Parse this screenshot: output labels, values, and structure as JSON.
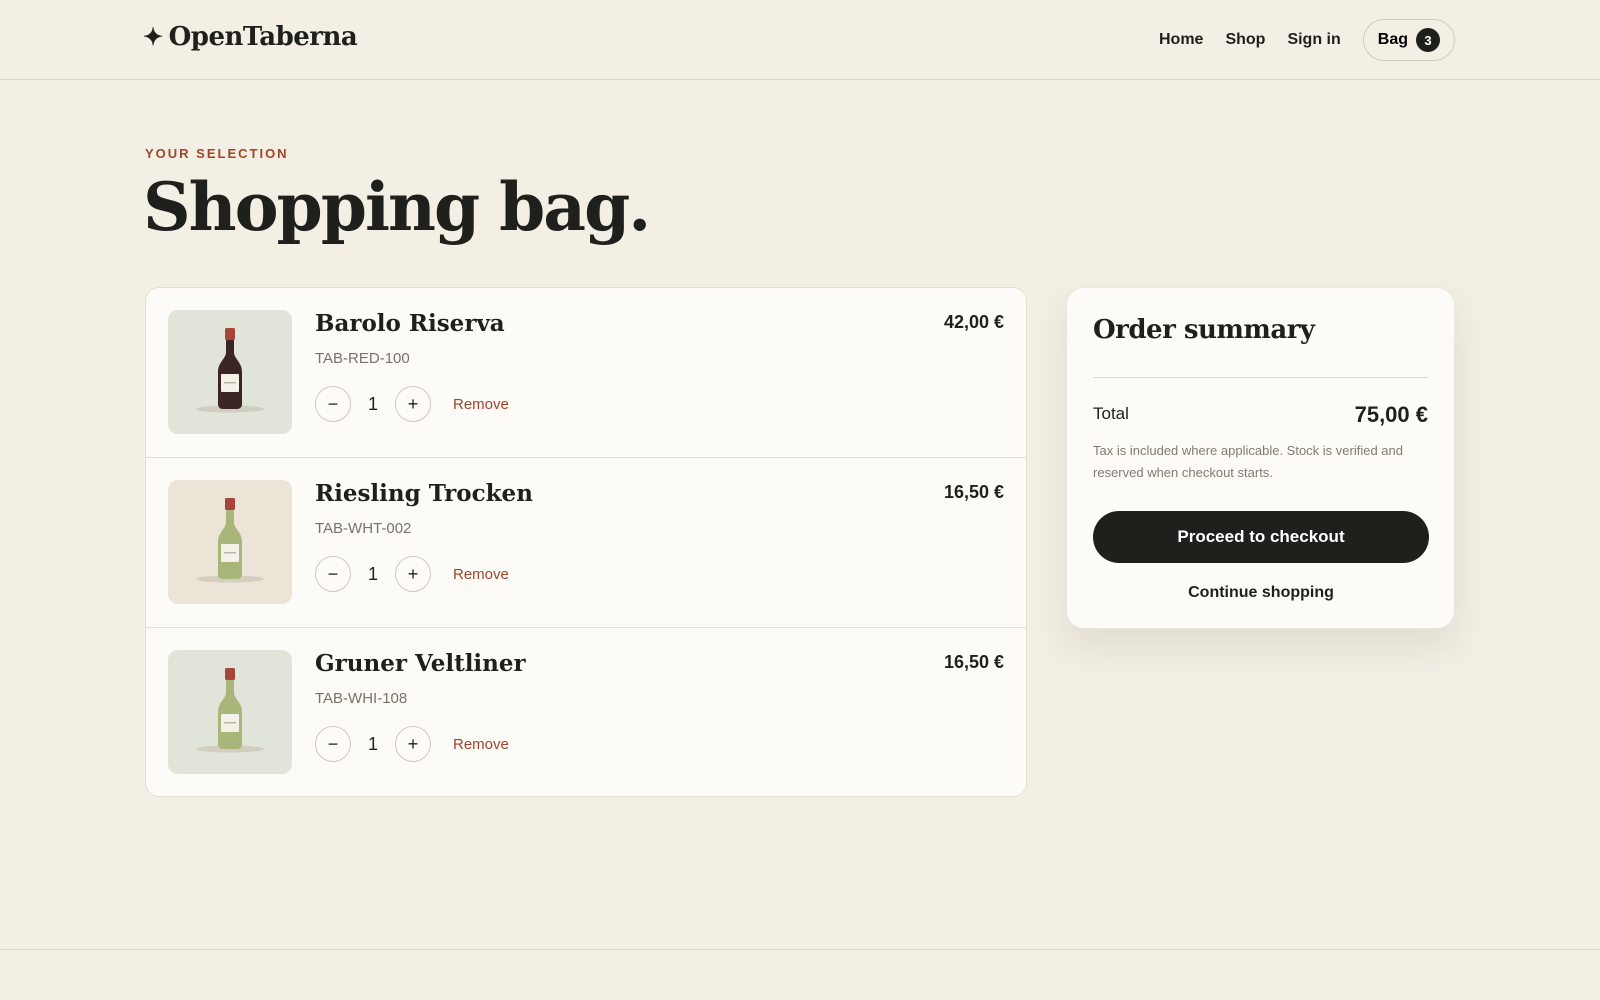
{
  "header": {
    "logo_text": "OpenTaberna",
    "nav": [
      {
        "label": "Home"
      },
      {
        "label": "Shop"
      },
      {
        "label": "Sign in"
      }
    ],
    "bag_label": "Bag",
    "bag_count": "3"
  },
  "page": {
    "eyebrow": "YOUR SELECTION",
    "title": "Shopping bag."
  },
  "cart": {
    "items": [
      {
        "name": "Barolo Riserva",
        "sku": "TAB-RED-100",
        "quantity": "1",
        "price": "42,00 €",
        "remove_label": "Remove",
        "icon": "red-wine-bottle-icon",
        "thumb_bg": "#e1e4d8",
        "bottle_color": "#3d2526",
        "cap_color": "#a6463a"
      },
      {
        "name": "Riesling Trocken",
        "sku": "TAB-WHT-002",
        "quantity": "1",
        "price": "16,50 €",
        "remove_label": "Remove",
        "icon": "white-wine-bottle-icon",
        "thumb_bg": "#ece4d6",
        "bottle_color": "#a9b67a",
        "cap_color": "#a6463a"
      },
      {
        "name": "Gruner Veltliner",
        "sku": "TAB-WHI-108",
        "quantity": "1",
        "price": "16,50 €",
        "remove_label": "Remove",
        "icon": "white-wine-bottle-icon",
        "thumb_bg": "#e1e4d8",
        "bottle_color": "#a9b67a",
        "cap_color": "#a6463a"
      }
    ],
    "decrement_symbol": "−",
    "increment_symbol": "+"
  },
  "summary": {
    "title": "Order summary",
    "total_label": "Total",
    "total_value": "75,00 €",
    "note": "Tax is included where applicable. Stock is verified and reserved when checkout starts.",
    "checkout_label": "Proceed to checkout",
    "continue_label": "Continue shopping"
  },
  "colors": {
    "background": "#f3efe4",
    "accent": "#a0452c",
    "primary": "#1f1f1c"
  }
}
